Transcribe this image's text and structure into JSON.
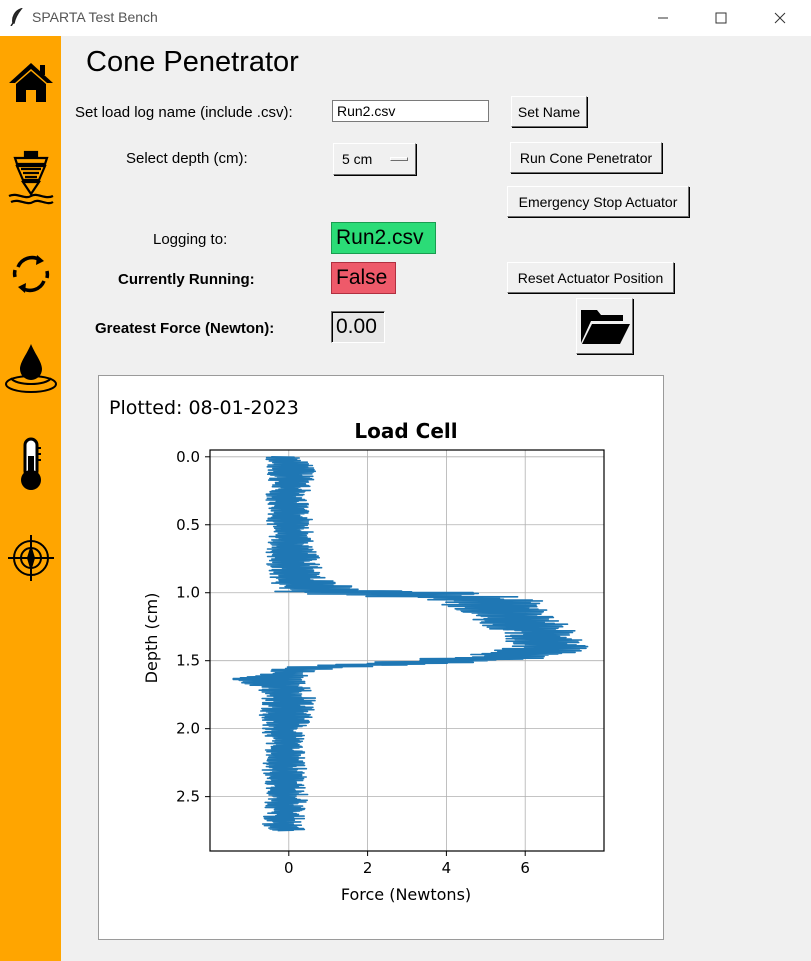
{
  "window": {
    "title": "SPARTA Test Bench"
  },
  "sidebar": {
    "items": [
      {
        "icon": "home-icon"
      },
      {
        "icon": "cone-penetrator-icon"
      },
      {
        "icon": "cycle-arrows-icon"
      },
      {
        "icon": "water-drop-icon"
      },
      {
        "icon": "thermometer-icon"
      },
      {
        "icon": "compass-target-icon"
      }
    ],
    "color": "#ffa500"
  },
  "page": {
    "title": "Cone Penetrator"
  },
  "form": {
    "log_name_label": "Set load log name (include .csv):",
    "log_name_value": "Run2.csv",
    "depth_label": "Select depth (cm):",
    "depth_value": "5 cm",
    "logging_label": "Logging to:",
    "logging_value": "Run2.csv",
    "running_label": "Currently Running:",
    "running_value": "False",
    "force_label": "Greatest Force (Newton):",
    "force_value": "0.00"
  },
  "buttons": {
    "set_name": "Set Name",
    "run": "Run Cone Penetrator",
    "emergency": "Emergency Stop Actuator",
    "reset": "Reset Actuator Position",
    "folder_icon": "open-folder-icon"
  },
  "colors": {
    "logging_bg": "#2bdc77",
    "running_bg": "#ee5a6a",
    "series": "#1f77b4"
  },
  "plot": {
    "timestamp": "Plotted: 08-01-2023"
  },
  "chart_data": {
    "type": "line",
    "title": "Load Cell",
    "xlabel": "Force (Newtons)",
    "ylabel": "Depth (cm)",
    "xlim": [
      -2.0,
      8.0
    ],
    "ylim": [
      2.9,
      -0.05
    ],
    "y_inverted": true,
    "xticks": [
      "0",
      "2",
      "4",
      "6"
    ],
    "xtick_values": [
      0,
      2,
      4,
      6
    ],
    "yticks": [
      "0.0",
      "0.5",
      "1.0",
      "1.5",
      "2.0",
      "2.5"
    ],
    "ytick_values": [
      0.0,
      0.5,
      1.0,
      1.5,
      2.0,
      2.5
    ],
    "grid": true,
    "series": [
      {
        "depth": [
          0.0,
          0.1,
          0.2,
          0.3,
          0.4,
          0.5,
          0.6,
          0.7,
          0.8,
          0.9,
          0.98,
          1.0,
          1.05,
          1.1,
          1.15,
          1.2,
          1.25,
          1.3,
          1.35,
          1.4,
          1.45,
          1.5,
          1.55,
          1.58,
          1.6,
          1.63,
          1.7,
          1.8,
          1.9,
          2.0,
          2.1,
          2.2,
          2.3,
          2.4,
          2.5,
          2.6,
          2.7,
          2.75
        ],
        "force_min": [
          -0.6,
          -0.6,
          -0.5,
          -0.6,
          -0.5,
          -0.6,
          -0.5,
          -0.6,
          -0.6,
          -0.5,
          -0.4,
          -0.3,
          3.5,
          4.0,
          4.4,
          4.6,
          5.0,
          5.3,
          5.5,
          5.6,
          4.8,
          2.5,
          -0.5,
          -0.8,
          -0.7,
          -1.6,
          -0.8,
          -0.7,
          -0.8,
          -0.7,
          -0.6,
          -0.6,
          -0.7,
          -0.6,
          -0.6,
          -0.6,
          -0.7,
          -0.6
        ],
        "force_max": [
          0.3,
          0.8,
          0.6,
          0.5,
          0.5,
          0.7,
          0.6,
          0.7,
          0.9,
          1.0,
          2.0,
          4.8,
          6.5,
          6.5,
          6.8,
          7.0,
          7.2,
          7.4,
          7.5,
          7.6,
          7.3,
          6.0,
          1.5,
          0.8,
          0.6,
          0.4,
          0.6,
          0.7,
          0.6,
          0.5,
          0.4,
          0.4,
          0.5,
          0.4,
          0.5,
          0.4,
          0.4,
          0.4
        ]
      }
    ]
  }
}
